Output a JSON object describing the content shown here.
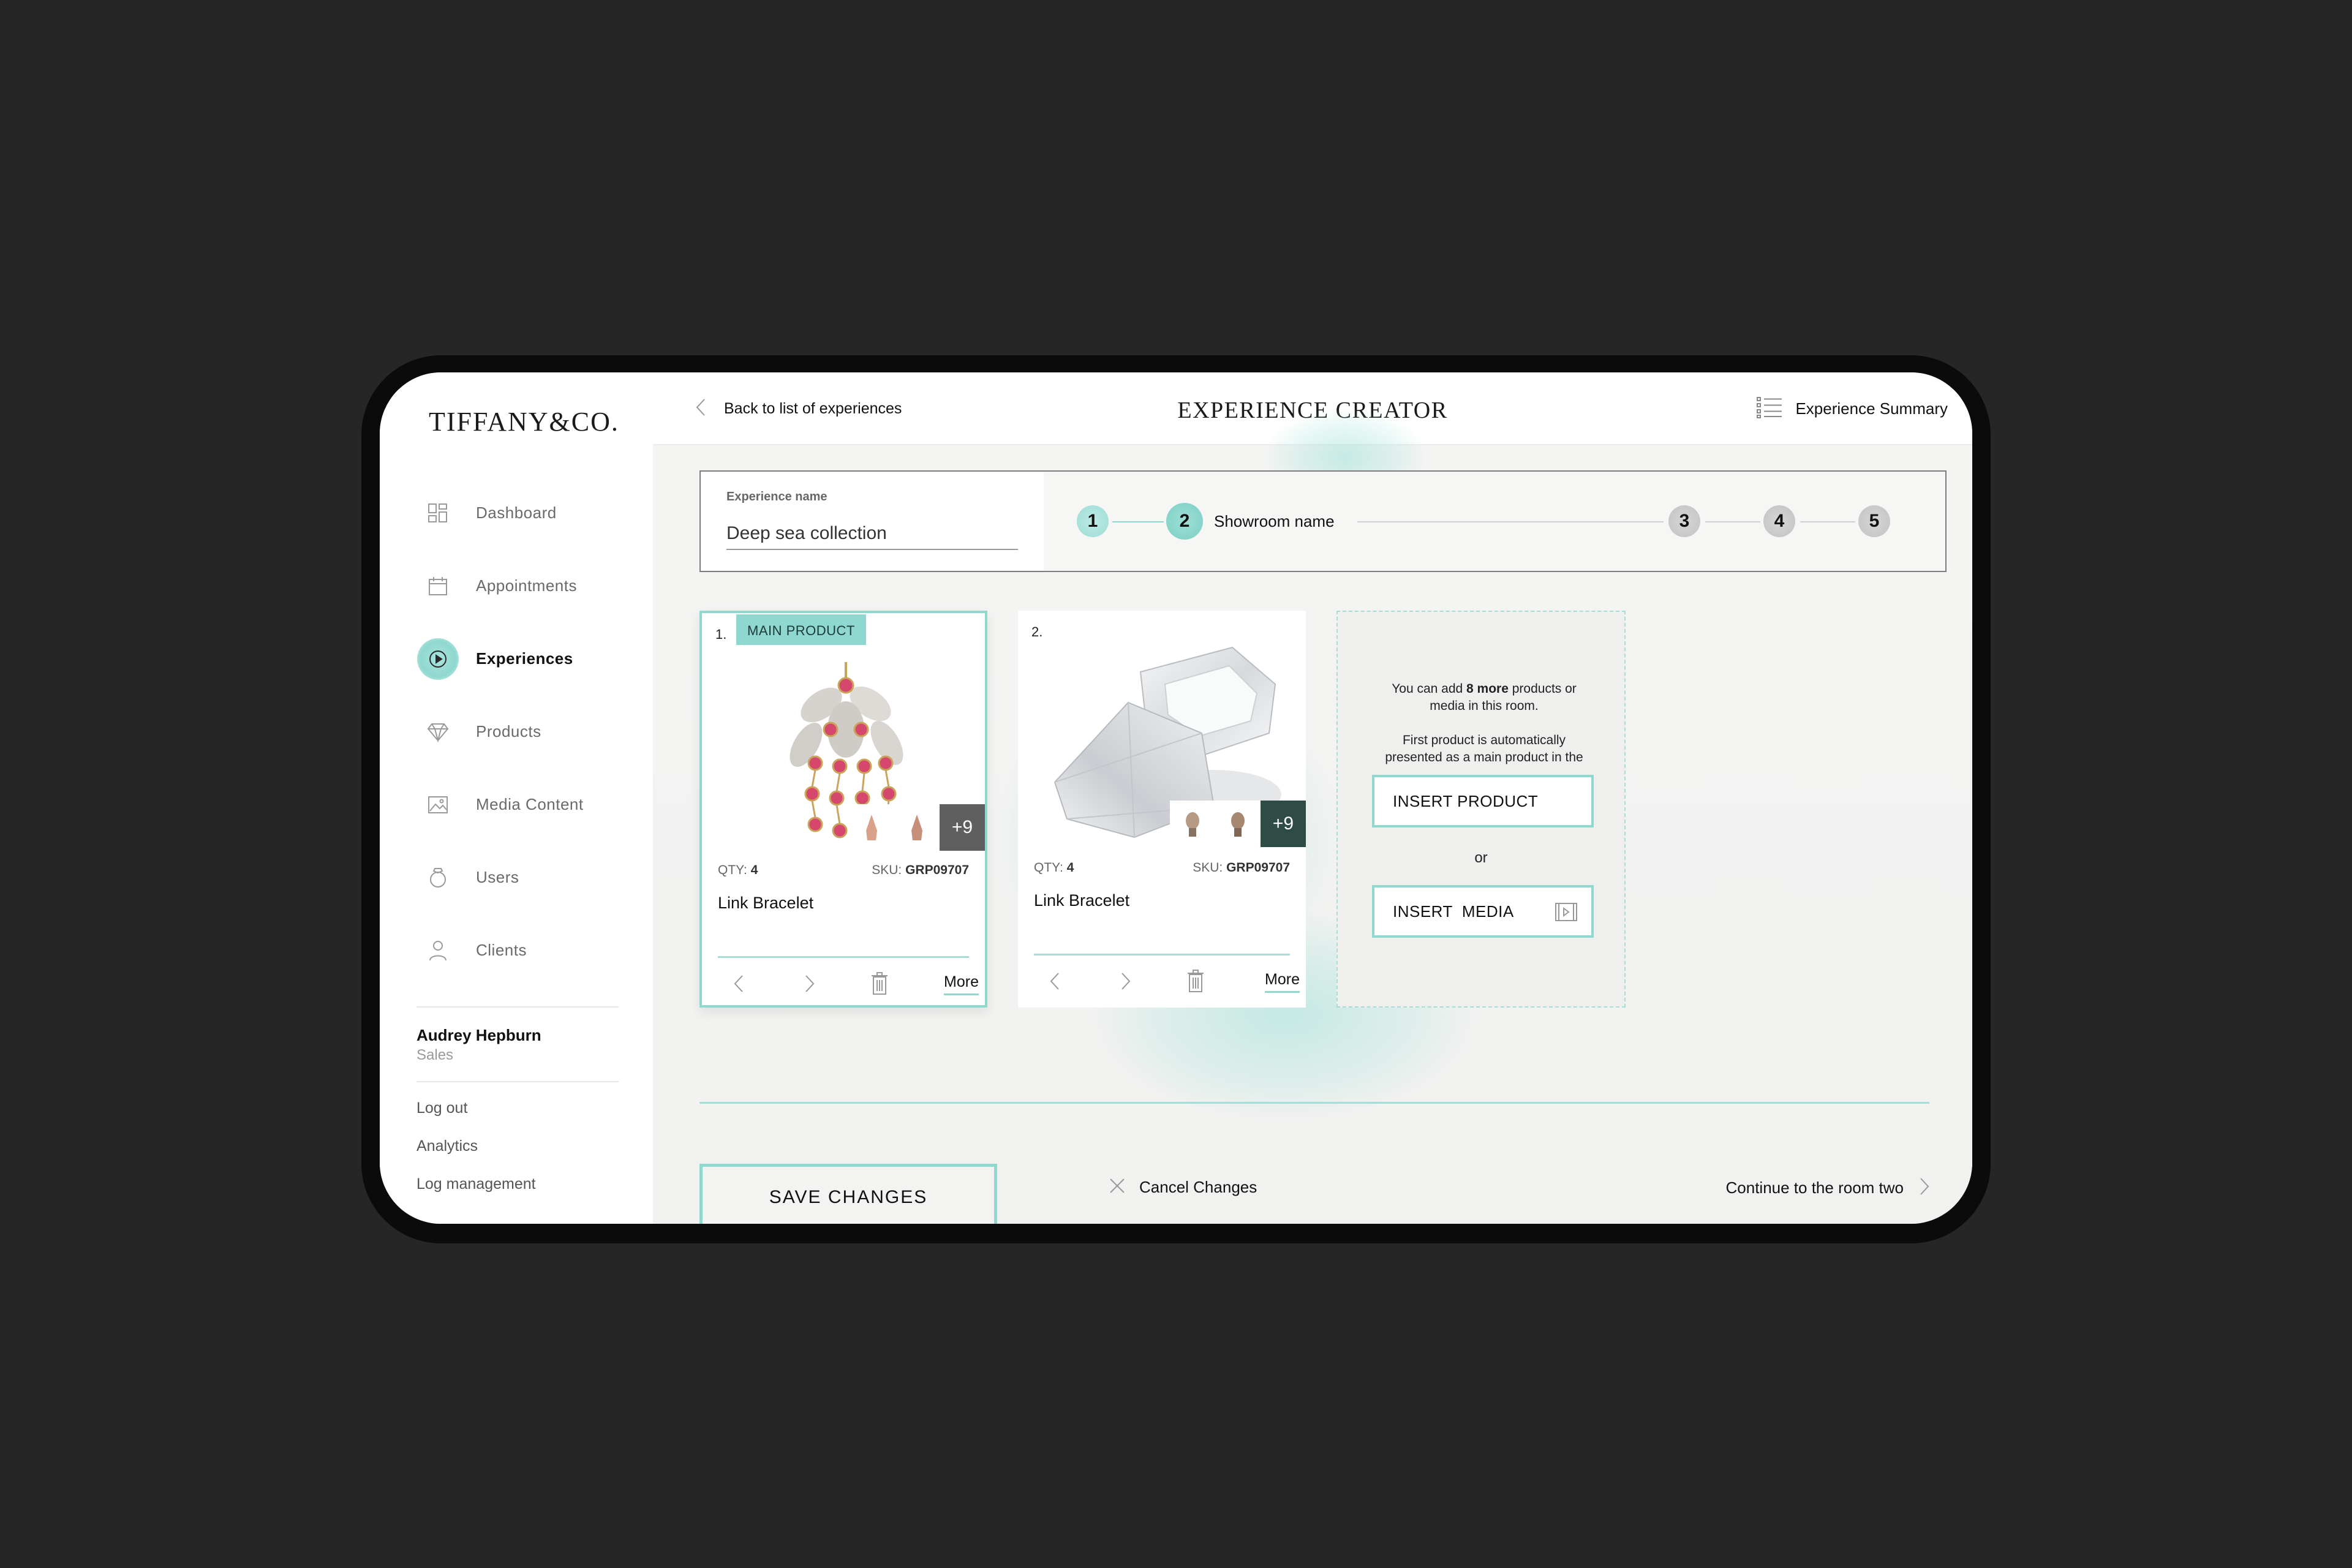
{
  "brand": {
    "logo_text": "TIFFANY&CO.",
    "accent": "#8fd8cf"
  },
  "sidebar": {
    "items": [
      {
        "label": "Dashboard",
        "icon": "dashboard-icon",
        "active": false
      },
      {
        "label": "Appointments",
        "icon": "calendar-icon",
        "active": false
      },
      {
        "label": "Experiences",
        "icon": "play-icon",
        "active": true
      },
      {
        "label": "Products",
        "icon": "diamond-icon",
        "active": false
      },
      {
        "label": "Media Content",
        "icon": "image-icon",
        "active": false
      },
      {
        "label": "Users",
        "icon": "ring-icon",
        "active": false
      },
      {
        "label": "Clients",
        "icon": "person-icon",
        "active": false
      }
    ],
    "user": {
      "name": "Audrey Hepburn",
      "role": "Sales"
    },
    "links": {
      "logout": "Log out",
      "analytics": "Analytics",
      "log_management": "Log management"
    }
  },
  "header": {
    "back_label": "Back to list of experiences",
    "title": "EXPERIENCE CREATOR",
    "summary_label": "Experience Summary"
  },
  "stepper": {
    "experience_name_label": "Experience name",
    "experience_name_value": "Deep sea collection",
    "steps": [
      "1",
      "2",
      "3",
      "4",
      "5"
    ],
    "current_step_label": "Showroom name"
  },
  "products": [
    {
      "index": "1.",
      "badge": "MAIN PRODUCT",
      "qty_label": "QTY:",
      "qty": "4",
      "sku_label": "SKU:",
      "sku": "GRP09707",
      "name": "Link Bracelet",
      "more_thumbs": "+9",
      "more_label": "More"
    },
    {
      "index": "2.",
      "qty_label": "QTY:",
      "qty": "4",
      "sku_label": "SKU:",
      "sku": "GRP09707",
      "name": "Link Bracelet",
      "more_thumbs": "+9",
      "more_label": "More"
    }
  ],
  "add_panel": {
    "text_pre": "You can add ",
    "count_text": "8 more",
    "text_post": " products or media in this room.",
    "note": "First product is automatically presented as a main product in the main room.",
    "insert_product": "INSERT PRODUCT",
    "or": "or",
    "insert_media": "INSERT  MEDIA"
  },
  "footer": {
    "save": "SAVE CHANGES",
    "cancel": "Cancel Changes",
    "continue": "Continue to the room two"
  }
}
